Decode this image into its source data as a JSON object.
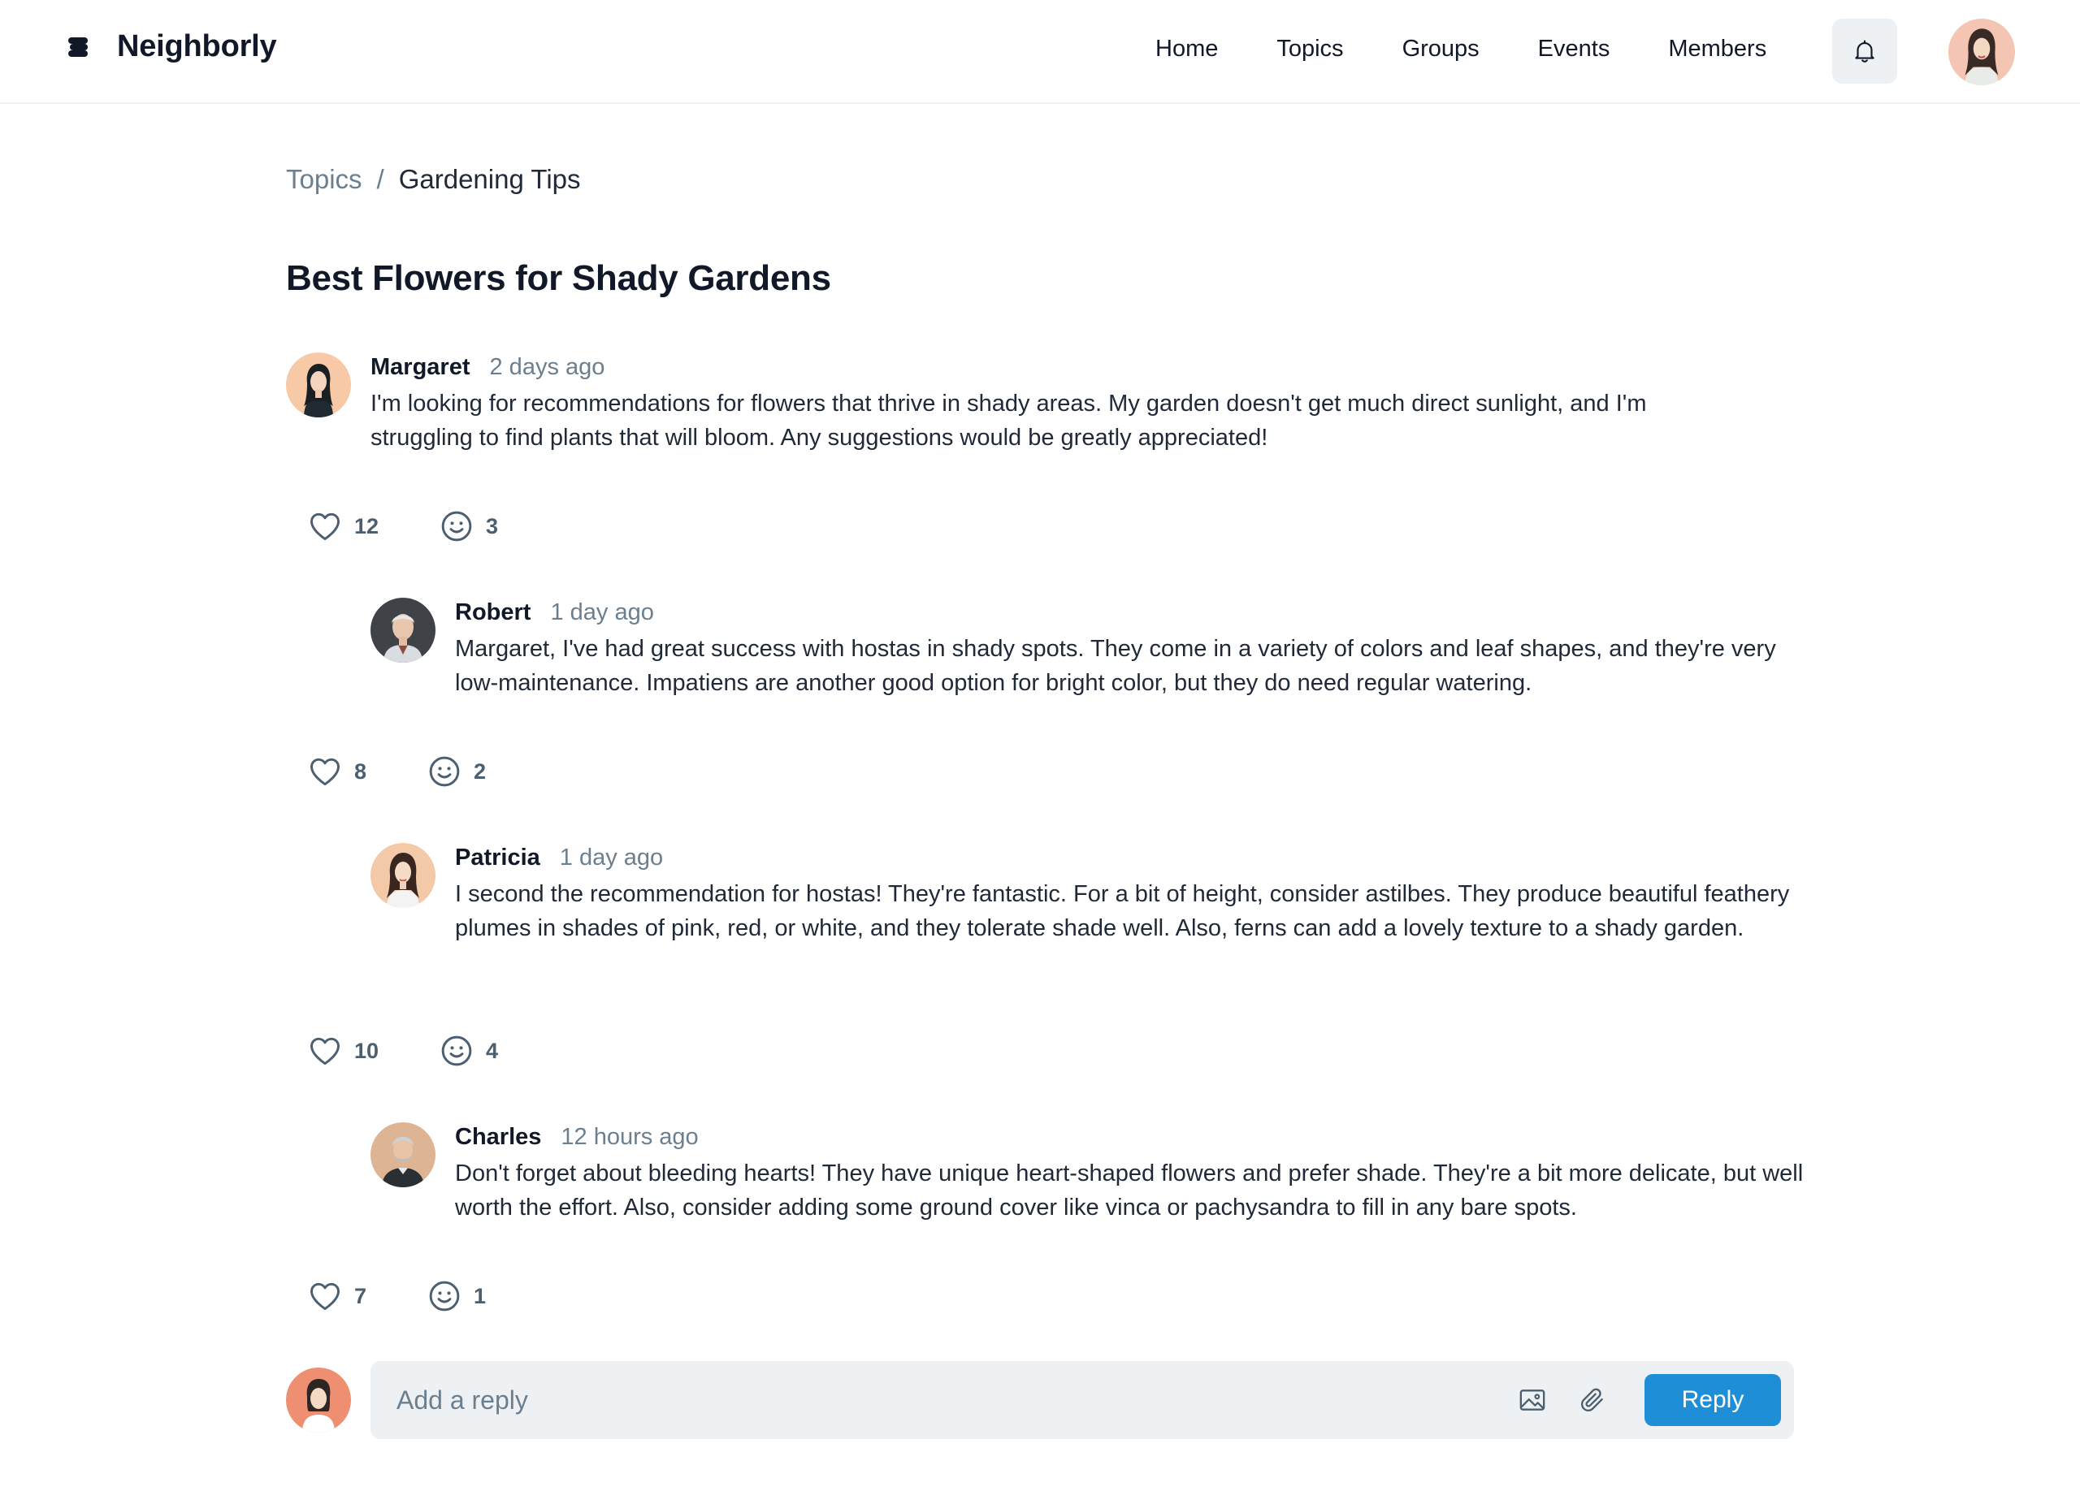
{
  "header": {
    "brand_name": "Neighborly",
    "nav": [
      "Home",
      "Topics",
      "Groups",
      "Events",
      "Members"
    ],
    "bell_icon": "bell-icon"
  },
  "breadcrumb": {
    "parent": "Topics",
    "separator": "/",
    "current": "Gardening Tips"
  },
  "thread": {
    "title": "Best Flowers for Shady Gardens"
  },
  "posts": [
    {
      "author": "Margaret",
      "time": "2 days ago",
      "body": "I'm looking for recommendations for flowers that thrive in shady areas. My garden doesn't get much direct sunlight, and I'm struggling to find plants that will bloom. Any suggestions would be greatly appreciated!",
      "likes": "12",
      "smiles": "3"
    },
    {
      "author": "Robert",
      "time": "1 day ago",
      "body": "Margaret, I've had great success with hostas in shady spots. They come in a variety of colors and leaf shapes, and they're very low-maintenance. Impatiens are another good option for bright color, but they do need regular watering.",
      "likes": "8",
      "smiles": "2"
    },
    {
      "author": "Patricia",
      "time": "1 day ago",
      "body": "I second the recommendation for hostas! They're fantastic. For a bit of height, consider astilbes. They produce beautiful feathery plumes in shades of pink, red, or white, and they tolerate shade well. Also, ferns can add a lovely texture to a shady garden.",
      "likes": "10",
      "smiles": "4"
    },
    {
      "author": "Charles",
      "time": "12 hours ago",
      "body": "Don't forget about bleeding hearts! They have unique heart-shaped flowers and prefer shade. They're a bit more delicate, but well worth the effort. Also, consider adding some ground cover like vinca or pachysandra to fill in any bare spots.",
      "likes": "7",
      "smiles": "1"
    }
  ],
  "reply": {
    "placeholder": "Add a reply",
    "button_label": "Reply"
  },
  "colors": {
    "accent": "#1e8fd6",
    "muted_text": "#6b7f8f",
    "surface": "#eef1f4"
  }
}
